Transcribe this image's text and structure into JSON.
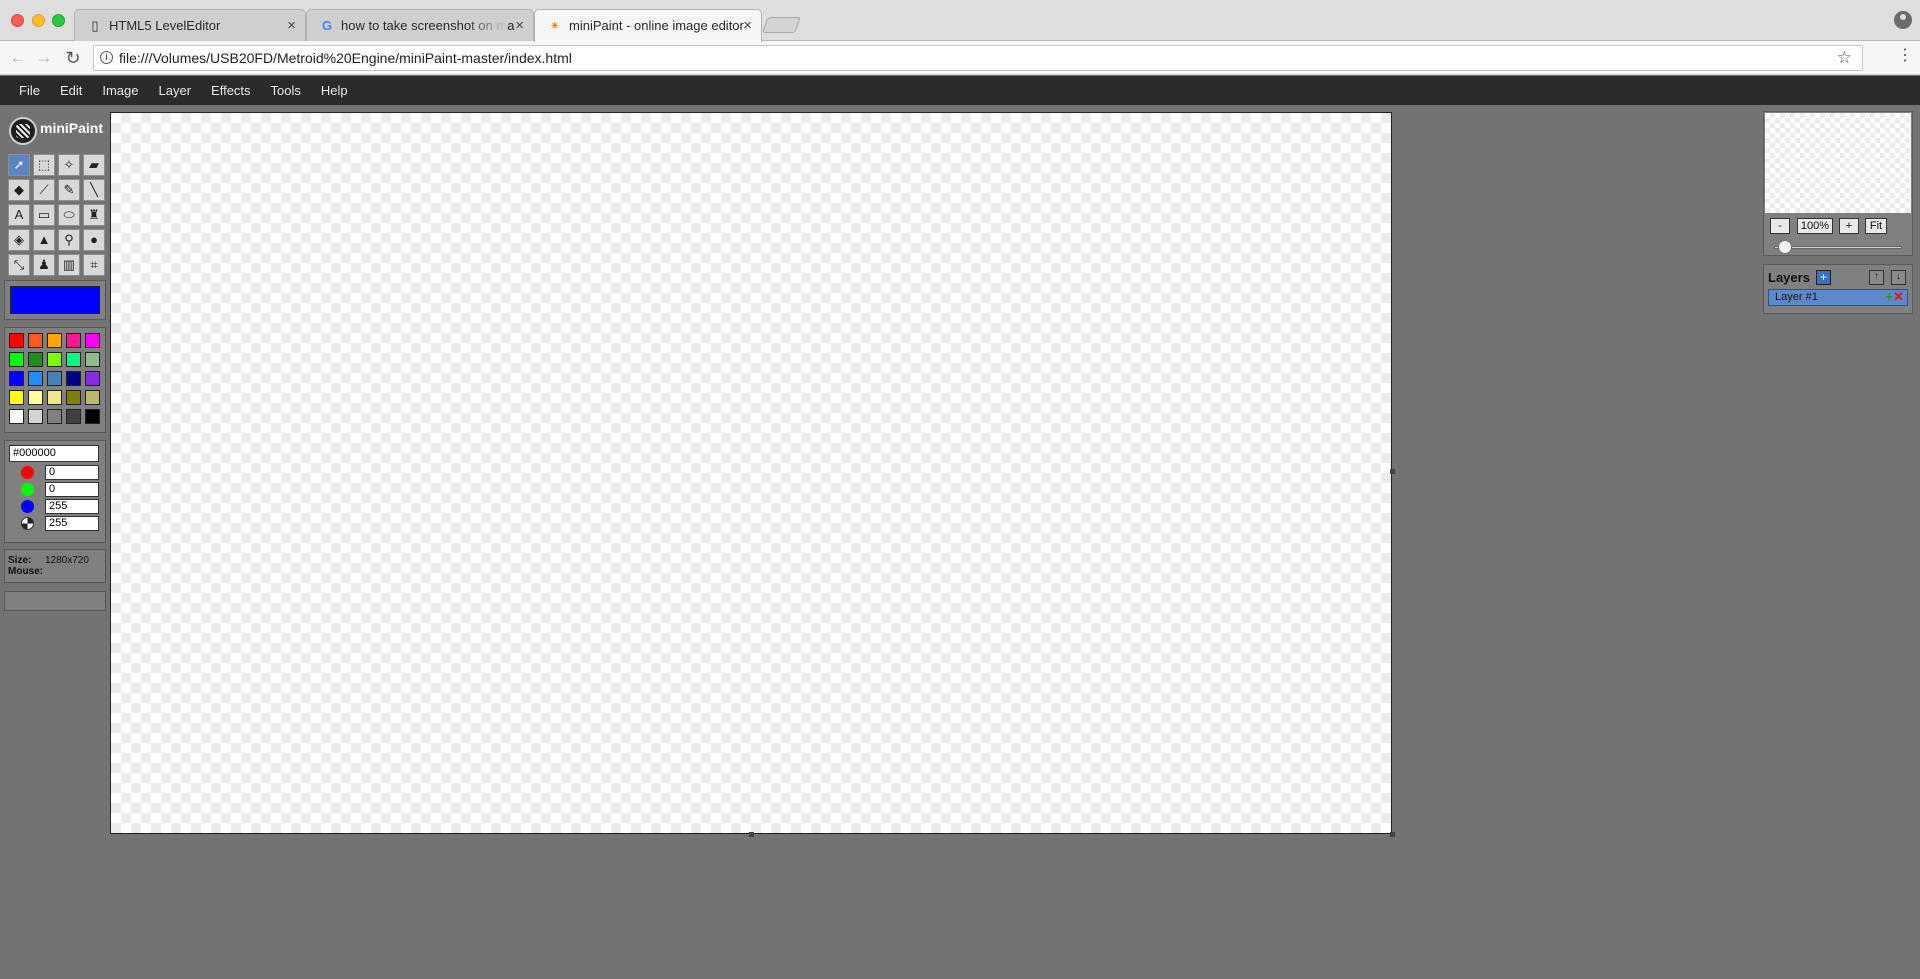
{
  "browser": {
    "tabs": [
      {
        "title": "HTML5 LevelEditor",
        "icon": "page-icon"
      },
      {
        "title": "how to take screenshot on ma",
        "icon": "google-icon"
      },
      {
        "title": "miniPaint - online image editor",
        "icon": "minipaint-icon"
      }
    ],
    "close_glyph": "×",
    "url": "file:///Volumes/USB20FD/Metroid%20Engine/miniPaint-master/index.html",
    "glyphs": {
      "back": "←",
      "forward": "→",
      "reload": "↻",
      "star": "☆",
      "menu": "⋮",
      "info": "i"
    }
  },
  "app": {
    "name": "miniPaint",
    "menu": [
      "File",
      "Edit",
      "Image",
      "Layer",
      "Effects",
      "Tools",
      "Help"
    ],
    "tools": [
      {
        "name": "select-tool",
        "glyph": "➚"
      },
      {
        "name": "rect-select-tool",
        "glyph": "⬚"
      },
      {
        "name": "magic-wand-tool",
        "glyph": "✧"
      },
      {
        "name": "eraser-tool",
        "glyph": "▰"
      },
      {
        "name": "fill-tool",
        "glyph": "◆"
      },
      {
        "name": "color-picker-tool",
        "glyph": "⟋"
      },
      {
        "name": "pencil-tool",
        "glyph": "✎"
      },
      {
        "name": "line-tool",
        "glyph": "╲"
      },
      {
        "name": "text-tool",
        "glyph": "A"
      },
      {
        "name": "rectangle-tool",
        "glyph": "▭"
      },
      {
        "name": "ellipse-tool",
        "glyph": "⬭"
      },
      {
        "name": "brush-tool",
        "glyph": "♜"
      },
      {
        "name": "blur-tool",
        "glyph": "◈"
      },
      {
        "name": "sharpen-tool",
        "glyph": "▲"
      },
      {
        "name": "zoom-tool",
        "glyph": "⚲"
      },
      {
        "name": "bulge-tool",
        "glyph": "●"
      },
      {
        "name": "resize-tool",
        "glyph": "⤡"
      },
      {
        "name": "clone-tool",
        "glyph": "♟"
      },
      {
        "name": "gradient-tool",
        "glyph": "▥"
      },
      {
        "name": "crop-tool",
        "glyph": "⌗"
      }
    ],
    "main_color": "#0000ff",
    "palette": [
      "#ff0000",
      "#ff5a1e",
      "#ffa500",
      "#ff1493",
      "#ff00ff",
      "#00ff00",
      "#228b22",
      "#7cfc00",
      "#00ff7f",
      "#8fbc8f",
      "#0000ff",
      "#1e90ff",
      "#4682b4",
      "#00008b",
      "#8a2be2",
      "#ffff00",
      "#ffff99",
      "#f0e68c",
      "#808000",
      "#bdb76b",
      "#ffffff",
      "#d3d3d3",
      "#808080",
      "#404040",
      "#000000"
    ],
    "hex_value": "#000000",
    "rgba": [
      {
        "channel": "red",
        "value": "0",
        "color": "#ff0000"
      },
      {
        "channel": "green",
        "value": "0",
        "color": "#00ff00"
      },
      {
        "channel": "blue",
        "value": "255",
        "color": "#0000ff"
      },
      {
        "channel": "alpha",
        "value": "255",
        "color": "#ffffff"
      }
    ],
    "info": {
      "size_label": "Size:",
      "size_value": "1280x720",
      "mouse_label": "Mouse:",
      "mouse_value": ""
    },
    "zoom": {
      "minus": "-",
      "value": "100%",
      "plus": "+",
      "fit": "Fit"
    },
    "layers": {
      "title": "Layers",
      "add": "+",
      "move_up": "↑",
      "move_down": "↓",
      "items": [
        {
          "name": "Layer #1"
        }
      ],
      "item_add": "+",
      "item_delete": "✕"
    }
  }
}
